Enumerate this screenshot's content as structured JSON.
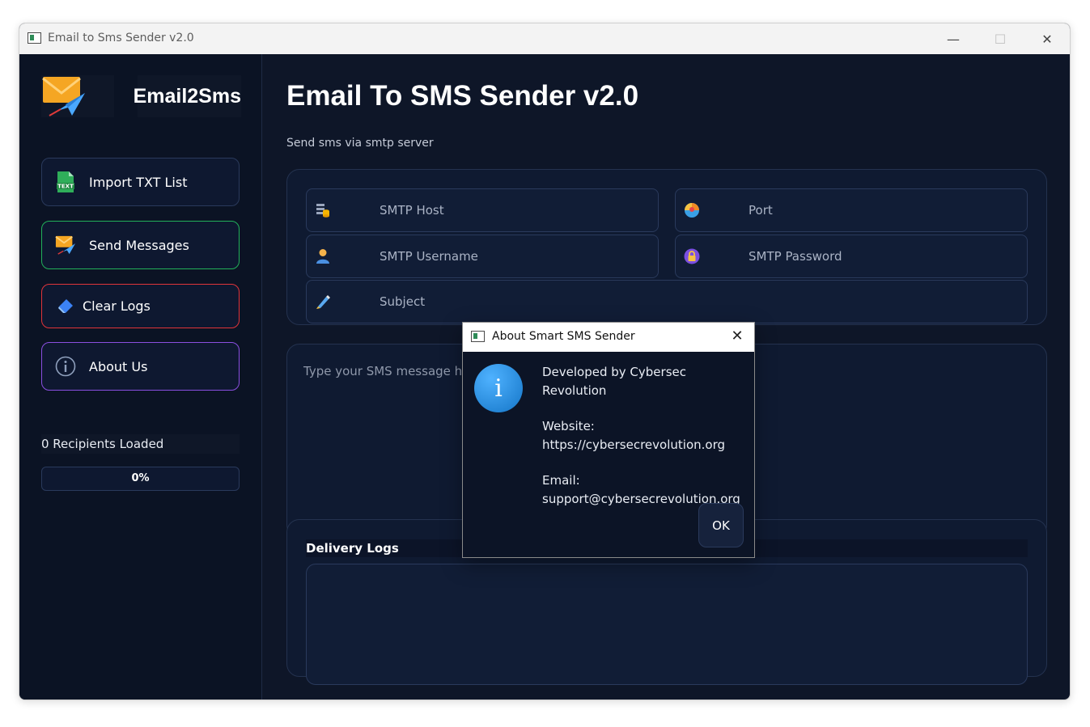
{
  "window": {
    "title": "Email to Sms Sender v2.0",
    "minimize": "—",
    "maximize": "☐",
    "close": "✕"
  },
  "sidebar": {
    "brand": "Email2Sms",
    "buttons": [
      {
        "label": "Import TXT List",
        "icon": "txt-file-icon"
      },
      {
        "label": "Send Messages",
        "icon": "send-mail-icon"
      },
      {
        "label": "Clear Logs",
        "icon": "eraser-icon"
      },
      {
        "label": "About Us",
        "icon": "info-icon"
      }
    ],
    "recipients_label": "0 Recipients Loaded",
    "progress_label": "0%",
    "progress_value": 0
  },
  "main": {
    "title": "Email To SMS Sender v2.0",
    "subtitle": "Send sms via smtp server",
    "fields": {
      "smtp_host": "SMTP Host",
      "port": "Port",
      "smtp_username": "SMTP Username",
      "smtp_password": "SMTP Password",
      "subject": "Subject"
    },
    "message_placeholder": "Type your SMS message here...",
    "logs_title": "Delivery Logs"
  },
  "dialog": {
    "title": "About Smart SMS Sender",
    "close": "✕",
    "icon": "i",
    "developed_by": "Developed by Cybersec Revolution",
    "website_label": "Website:",
    "website_url": "https://cybersecrevolution.org",
    "email_label": "Email:",
    "email_value": "support@cybersecrevolution.org",
    "ok_label": "OK"
  },
  "colors": {
    "background": "#0e1628",
    "send_border": "#22b05a",
    "clear_border": "#e0343a",
    "about_border": "#8a4fe0",
    "info_blue": "#1475c7"
  }
}
